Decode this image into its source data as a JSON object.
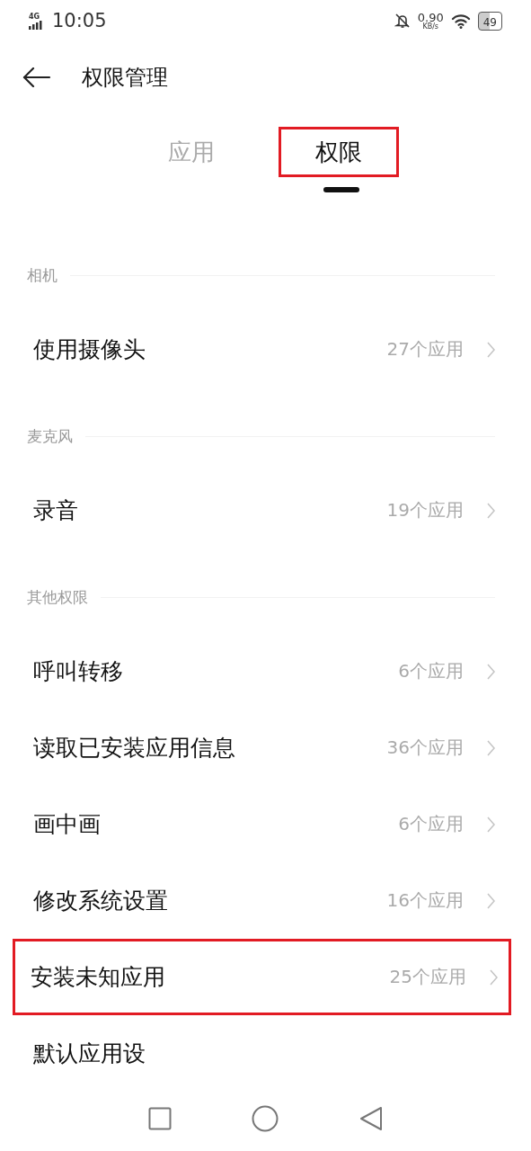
{
  "status_bar": {
    "network": "4G",
    "time": "10:05",
    "speed": "0.90",
    "speed_unit": "KB/s",
    "battery": "49"
  },
  "header": {
    "title": "权限管理"
  },
  "tabs": [
    {
      "label": "应用",
      "selected": false,
      "annotated": false
    },
    {
      "label": "权限",
      "selected": true,
      "annotated": true
    }
  ],
  "sections": [
    {
      "title": "相机",
      "items": [
        {
          "label": "使用摄像头",
          "count": "27个应用",
          "annotated": false
        }
      ]
    },
    {
      "title": "麦克风",
      "items": [
        {
          "label": "录音",
          "count": "19个应用",
          "annotated": false
        }
      ]
    },
    {
      "title": "其他权限",
      "items": [
        {
          "label": "呼叫转移",
          "count": "6个应用",
          "annotated": false
        },
        {
          "label": "读取已安装应用信息",
          "count": "36个应用",
          "annotated": false
        },
        {
          "label": "画中画",
          "count": "6个应用",
          "annotated": false
        },
        {
          "label": "修改系统设置",
          "count": "16个应用",
          "annotated": false
        },
        {
          "label": "安装未知应用",
          "count": "25个应用",
          "annotated": true
        },
        {
          "label": "默认应用设"
        }
      ]
    }
  ]
}
